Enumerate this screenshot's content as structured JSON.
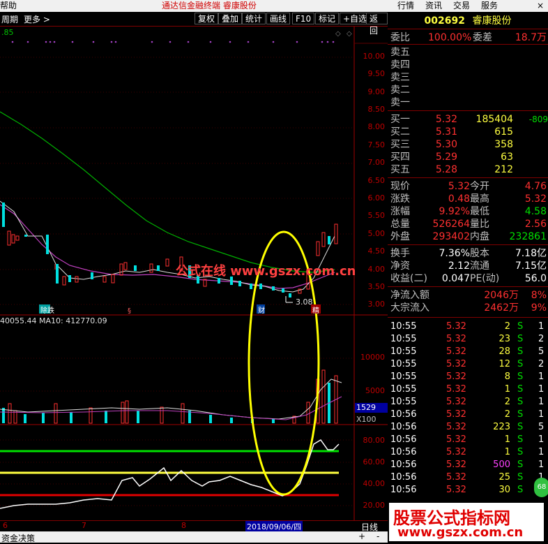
{
  "menu": {
    "help": "帮助",
    "center_title": "通达信金融终端  睿康股份"
  },
  "right_tabs": [
    "行情",
    "资讯",
    "交易",
    "服务"
  ],
  "close_label": "×",
  "toolbar": {
    "period": "周期",
    "more": "更多 >",
    "buttons": [
      "复权",
      "叠加",
      "统计",
      "画线",
      "F10",
      "标记",
      "+自选",
      "返回"
    ]
  },
  "chart_header": {
    "left_value": ".85"
  },
  "price_axis": [
    "10.00",
    "9.50",
    "9.00",
    "8.50",
    "8.00",
    "7.50",
    "7.00",
    "6.50",
    "6.00",
    "5.50",
    "5.00",
    "4.50",
    "4.00",
    "3.50",
    "3.00"
  ],
  "volume_axis": [
    "10000",
    "5000"
  ],
  "volume_header": "40055.44  MA10: 412770.09",
  "volume_box": {
    "value": "1529",
    "unit": "X100"
  },
  "indicator_axis": [
    "80.00",
    "60.00",
    "40.00",
    "20.00"
  ],
  "annotations": {
    "low_price": "3.08",
    "tag1": "除跌",
    "tag2": "财",
    "tag3": "精"
  },
  "watermark": "公式在线  www.gszx.com.cn",
  "date_axis": {
    "labels": [
      "6",
      "7",
      "8"
    ],
    "current_date": "2018/09/06/四",
    "period_label": "日线"
  },
  "status": {
    "left": "资金决策",
    "plus": "+",
    "minus": "-"
  },
  "quote": {
    "code": "002692",
    "name": "睿康股份",
    "weibi_label": "委比",
    "weibi": "100.00%",
    "weicha_label": "委差",
    "weicha": "18.7万",
    "sells": [
      {
        "l": "卖五",
        "p": "",
        "v": ""
      },
      {
        "l": "卖四",
        "p": "",
        "v": ""
      },
      {
        "l": "卖三",
        "p": "",
        "v": ""
      },
      {
        "l": "卖二",
        "p": "",
        "v": ""
      },
      {
        "l": "卖一",
        "p": "",
        "v": ""
      }
    ],
    "buys": [
      {
        "l": "买一",
        "p": "5.32",
        "v": "185404",
        "d": "-809"
      },
      {
        "l": "买二",
        "p": "5.31",
        "v": "615",
        "d": ""
      },
      {
        "l": "买三",
        "p": "5.30",
        "v": "358",
        "d": ""
      },
      {
        "l": "买四",
        "p": "5.29",
        "v": "63",
        "d": ""
      },
      {
        "l": "买五",
        "p": "5.28",
        "v": "212",
        "d": ""
      }
    ],
    "stats": [
      {
        "l1": "现价",
        "v1": "5.32",
        "l2": "今开",
        "v2": "4.76"
      },
      {
        "l1": "涨跌",
        "v1": "0.48",
        "l2": "最高",
        "v2": "5.32"
      },
      {
        "l1": "涨幅",
        "v1": "9.92%",
        "l2": "最低",
        "v2": "4.58"
      },
      {
        "l1": "总量",
        "v1": "526264",
        "l2": "量比",
        "v2": "2.56"
      },
      {
        "l1": "外盘",
        "v1": "293402",
        "l2": "内盘",
        "v2": "232861"
      }
    ],
    "stats2": [
      {
        "l1": "换手",
        "v1": "7.36%",
        "l2": "股本",
        "v2": "7.18亿"
      },
      {
        "l1": "净资",
        "v1": "2.12",
        "l2": "流通",
        "v2": "7.15亿"
      },
      {
        "l1": "收益(二)",
        "v1": "0.047",
        "l2": "PE(动)",
        "v2": "56.0"
      }
    ],
    "flows": [
      {
        "l": "净流入额",
        "v": "2046万",
        "p": "8%"
      },
      {
        "l": "大宗流入",
        "v": "2462万",
        "p": "9%"
      }
    ],
    "ticks": [
      {
        "t": "10:55",
        "p": "5.32",
        "v": "2",
        "s": "S",
        "n": "1"
      },
      {
        "t": "10:55",
        "p": "5.32",
        "v": "23",
        "s": "S",
        "n": "2"
      },
      {
        "t": "10:55",
        "p": "5.32",
        "v": "28",
        "s": "S",
        "n": "5"
      },
      {
        "t": "10:55",
        "p": "5.32",
        "v": "12",
        "s": "S",
        "n": "2"
      },
      {
        "t": "10:55",
        "p": "5.32",
        "v": "8",
        "s": "S",
        "n": "1"
      },
      {
        "t": "10:55",
        "p": "5.32",
        "v": "1",
        "s": "S",
        "n": "1"
      },
      {
        "t": "10:55",
        "p": "5.32",
        "v": "2",
        "s": "S",
        "n": "1"
      },
      {
        "t": "10:56",
        "p": "5.32",
        "v": "2",
        "s": "S",
        "n": "1"
      },
      {
        "t": "10:56",
        "p": "5.32",
        "v": "223",
        "s": "S",
        "n": "5"
      },
      {
        "t": "10:56",
        "p": "5.32",
        "v": "1",
        "s": "S",
        "n": "1"
      },
      {
        "t": "10:56",
        "p": "5.32",
        "v": "1",
        "s": "S",
        "n": "1"
      },
      {
        "t": "10:56",
        "p": "5.32",
        "v": "500",
        "s": "S",
        "n": "1"
      },
      {
        "t": "10:56",
        "p": "5.32",
        "v": "25",
        "s": "S",
        "n": "1"
      },
      {
        "t": "10:56",
        "p": "5.32",
        "v": "30",
        "s": "S",
        "n": "1"
      }
    ]
  },
  "banner": {
    "line1": "股票公式指标网",
    "line2": "www.gszx.com.cn"
  },
  "colors": {
    "accent_red": "#ff3030",
    "up": "#ff3030",
    "down": "#00ffff",
    "ma_green": "#00c000",
    "ma_magenta": "#d040d0"
  }
}
